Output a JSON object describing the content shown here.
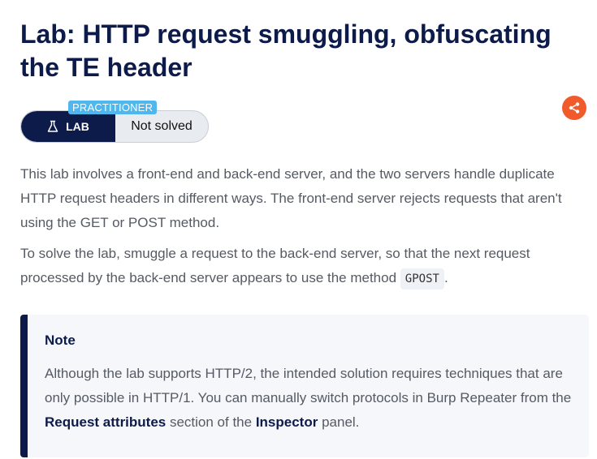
{
  "page": {
    "title": "Lab: HTTP request smuggling, obfuscating the TE header"
  },
  "badge": {
    "level": "PRACTITIONER",
    "lab_label": "LAB",
    "status": "Not solved"
  },
  "share": {
    "icon": "share-icon",
    "color": "#f15a2b"
  },
  "description": {
    "p1": "This lab involves a front-end and back-end server, and the two servers handle duplicate HTTP request headers in different ways. The front-end server rejects requests that aren't using the GET or POST method.",
    "p2_before": "To solve the lab, smuggle a request to the back-end server, so that the next request processed by the back-end server appears to use the method ",
    "p2_code": "GPOST",
    "p2_after": "."
  },
  "note": {
    "title": "Note",
    "text_1": "Although the lab supports HTTP/2, the intended solution requires techniques that are only possible in HTTP/1. You can manually switch protocols in Burp Repeater from the ",
    "strong_1": "Request attributes",
    "text_2": " section of the ",
    "strong_2": "Inspector",
    "text_3": " panel."
  },
  "colors": {
    "navy": "#0d1b4b",
    "badge_level": "#4fb7ee",
    "body_text": "#555a63",
    "note_bg": "#f5f7fb"
  }
}
